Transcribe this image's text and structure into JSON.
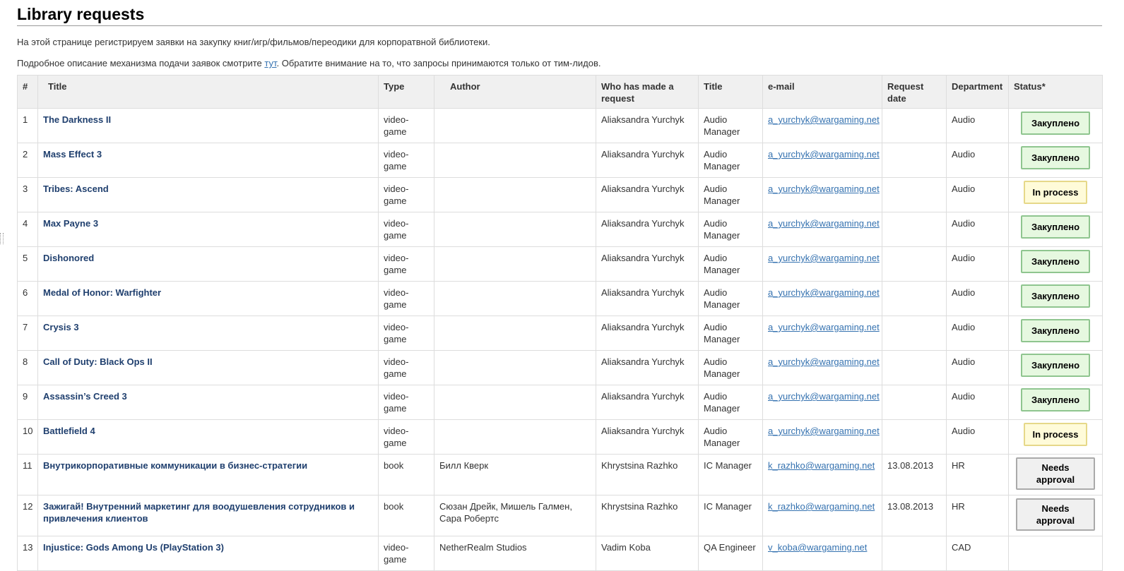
{
  "page": {
    "title": "Library requests",
    "intro1": "На этой странице регистрируем заявки на закупку книг/игр/фильмов/переодики для корпоратвной библиотеки.",
    "intro2_before": "Подробное описание механизма подачи заявок смотрите ",
    "intro2_link": "тут",
    "intro2_after": ". Обратите внимание на то, что запросы принимаются только от тим-лидов."
  },
  "table": {
    "headers": {
      "num": "#",
      "title": "Title",
      "type": "Type",
      "author": "Author",
      "who": "Who has made a request",
      "role": "Title",
      "email": "e-mail",
      "date": "Request date",
      "department": "Department",
      "status": "Status*"
    },
    "rows": [
      {
        "num": "1",
        "title": "The Darkness II",
        "type": "video-game",
        "author": "",
        "who": "Aliaksandra Yurchyk",
        "role": "Audio Manager",
        "email": "a_yurchyk@wargaming.net",
        "date": "",
        "department": "Audio",
        "status": "Закуплено",
        "status_kind": "green"
      },
      {
        "num": "2",
        "title": "Mass Effect 3",
        "type": "video-game",
        "author": "",
        "who": "Aliaksandra Yurchyk",
        "role": "Audio Manager",
        "email": "a_yurchyk@wargaming.net",
        "date": "",
        "department": "Audio",
        "status": "Закуплено",
        "status_kind": "green"
      },
      {
        "num": "3",
        "title": "Tribes: Ascend",
        "type": "video-game",
        "author": "",
        "who": "Aliaksandra Yurchyk",
        "role": "Audio Manager",
        "email": "a_yurchyk@wargaming.net",
        "date": "",
        "department": "Audio",
        "status": "In process",
        "status_kind": "yellow"
      },
      {
        "num": "4",
        "title": "Max Payne 3",
        "type": "video-game",
        "author": "",
        "who": "Aliaksandra Yurchyk",
        "role": "Audio Manager",
        "email": "a_yurchyk@wargaming.net",
        "date": "",
        "department": "Audio",
        "status": "Закуплено",
        "status_kind": "green"
      },
      {
        "num": "5",
        "title": "Dishonored",
        "type": "video-game",
        "author": "",
        "who": "Aliaksandra Yurchyk",
        "role": "Audio Manager",
        "email": "a_yurchyk@wargaming.net",
        "date": "",
        "department": "Audio",
        "status": "Закуплено",
        "status_kind": "green"
      },
      {
        "num": "6",
        "title": "Medal of Honor: Warfighter",
        "type": "video-game",
        "author": "",
        "who": "Aliaksandra Yurchyk",
        "role": "Audio Manager",
        "email": "a_yurchyk@wargaming.net",
        "date": "",
        "department": "Audio",
        "status": "Закуплено",
        "status_kind": "green"
      },
      {
        "num": "7",
        "title": "Crysis 3",
        "type": "video-game",
        "author": "",
        "who": "Aliaksandra Yurchyk",
        "role": "Audio Manager",
        "email": "a_yurchyk@wargaming.net",
        "date": "",
        "department": "Audio",
        "status": "Закуплено",
        "status_kind": "green"
      },
      {
        "num": "8",
        "title": "Call of Duty: Black Ops II",
        "type": "video-game",
        "author": "",
        "who": "Aliaksandra Yurchyk",
        "role": "Audio Manager",
        "email": "a_yurchyk@wargaming.net",
        "date": "",
        "department": "Audio",
        "status": "Закуплено",
        "status_kind": "green"
      },
      {
        "num": "9",
        "title": "Assassin’s Creed 3",
        "type": "video-game",
        "author": "",
        "who": "Aliaksandra Yurchyk",
        "role": "Audio Manager",
        "email": "a_yurchyk@wargaming.net",
        "date": "",
        "department": "Audio",
        "status": "Закуплено",
        "status_kind": "green"
      },
      {
        "num": "10",
        "title": "Battlefield 4",
        "type": "video-game",
        "author": "",
        "who": "Aliaksandra Yurchyk",
        "role": "Audio Manager",
        "email": "a_yurchyk@wargaming.net",
        "date": "",
        "department": "Audio",
        "status": "In process",
        "status_kind": "yellow"
      },
      {
        "num": "11",
        "title": "Внутрикорпоративные коммуникации в бизнес-стратегии",
        "type": "book",
        "author": "Билл Кверк",
        "who": "Khrystsina Razhko",
        "role": "IC Manager",
        "email": "k_razhko@wargaming.net",
        "date": "13.08.2013",
        "department": "HR",
        "status": "Needs approval",
        "status_kind": "gray"
      },
      {
        "num": "12",
        "title": "Зажигай! Внутренний маркетинг для воодушевления сотрудников и привлечения клиентов",
        "type": "book",
        "author": "Сюзан Дрейк, Мишель Галмен, Сара Робертс",
        "who": "Khrystsina Razhko",
        "role": "IC Manager",
        "email": "k_razhko@wargaming.net",
        "date": "13.08.2013",
        "department": "HR",
        "status": "Needs approval",
        "status_kind": "gray"
      },
      {
        "num": "13",
        "title": "Injustice: Gods Among Us (PlayStation 3)",
        "type": "video-game",
        "author": "NetherRealm Studios",
        "who": "Vadim Koba",
        "role": "QA Engineer",
        "email": "v_koba@wargaming.net",
        "date": "",
        "department": "CAD",
        "status": "",
        "status_kind": "none"
      }
    ]
  },
  "colors": {
    "link": "#3572b0",
    "title_link": "#1f3f6e",
    "status_green_bg": "#e6f8e0",
    "status_yellow_bg": "#fffbd9",
    "status_gray_bg": "#f0f0f0"
  }
}
